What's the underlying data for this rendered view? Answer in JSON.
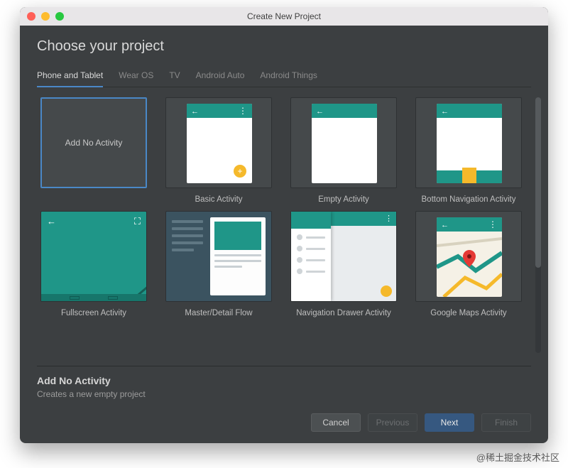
{
  "titlebar": {
    "title": "Create New Project"
  },
  "heading": "Choose your project",
  "tabs": [
    {
      "label": "Phone and Tablet",
      "active": true
    },
    {
      "label": "Wear OS",
      "active": false
    },
    {
      "label": "TV",
      "active": false
    },
    {
      "label": "Android Auto",
      "active": false
    },
    {
      "label": "Android Things",
      "active": false
    }
  ],
  "templates": [
    {
      "label": "Add No Activity",
      "kind": "none",
      "selected": true
    },
    {
      "label": "Basic Activity",
      "kind": "basic",
      "selected": false
    },
    {
      "label": "Empty Activity",
      "kind": "empty",
      "selected": false
    },
    {
      "label": "Bottom Navigation Activity",
      "kind": "bottomnav",
      "selected": false
    },
    {
      "label": "Fullscreen Activity",
      "kind": "fullscreen",
      "selected": false
    },
    {
      "label": "Master/Detail Flow",
      "kind": "masterdetail",
      "selected": false
    },
    {
      "label": "Navigation Drawer Activity",
      "kind": "navdrawer",
      "selected": false
    },
    {
      "label": "Google Maps Activity",
      "kind": "maps",
      "selected": false
    }
  ],
  "details": {
    "title": "Add No Activity",
    "description": "Creates a new empty project"
  },
  "buttons": {
    "cancel": "Cancel",
    "previous": "Previous",
    "next": "Next",
    "finish": "Finish"
  },
  "watermark": "@稀土掘金技术社区",
  "colors": {
    "accent": "#4a88c7",
    "teal": "#1f9688",
    "amber": "#f5b92b"
  }
}
